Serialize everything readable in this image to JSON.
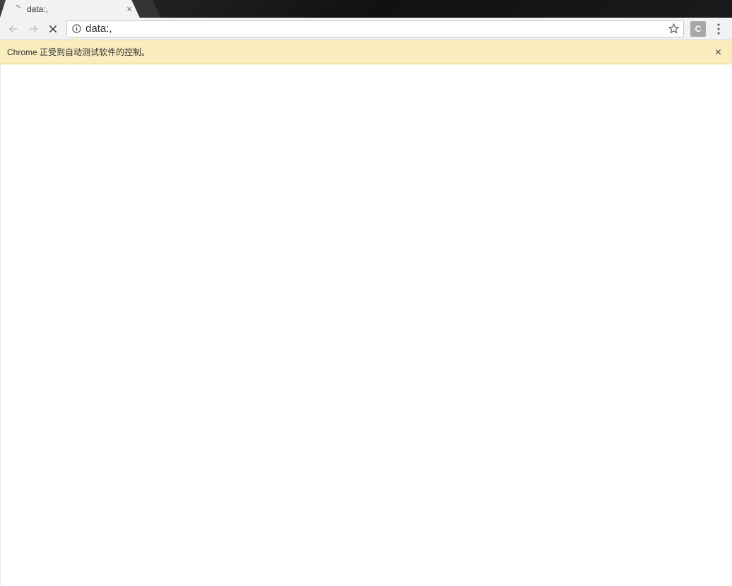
{
  "tab": {
    "title": "data:,",
    "close_glyph": "×"
  },
  "toolbar": {
    "url": "data:,",
    "extension_label": "C"
  },
  "infobar": {
    "message": "Chrome 正受到自动测试软件的控制。"
  }
}
